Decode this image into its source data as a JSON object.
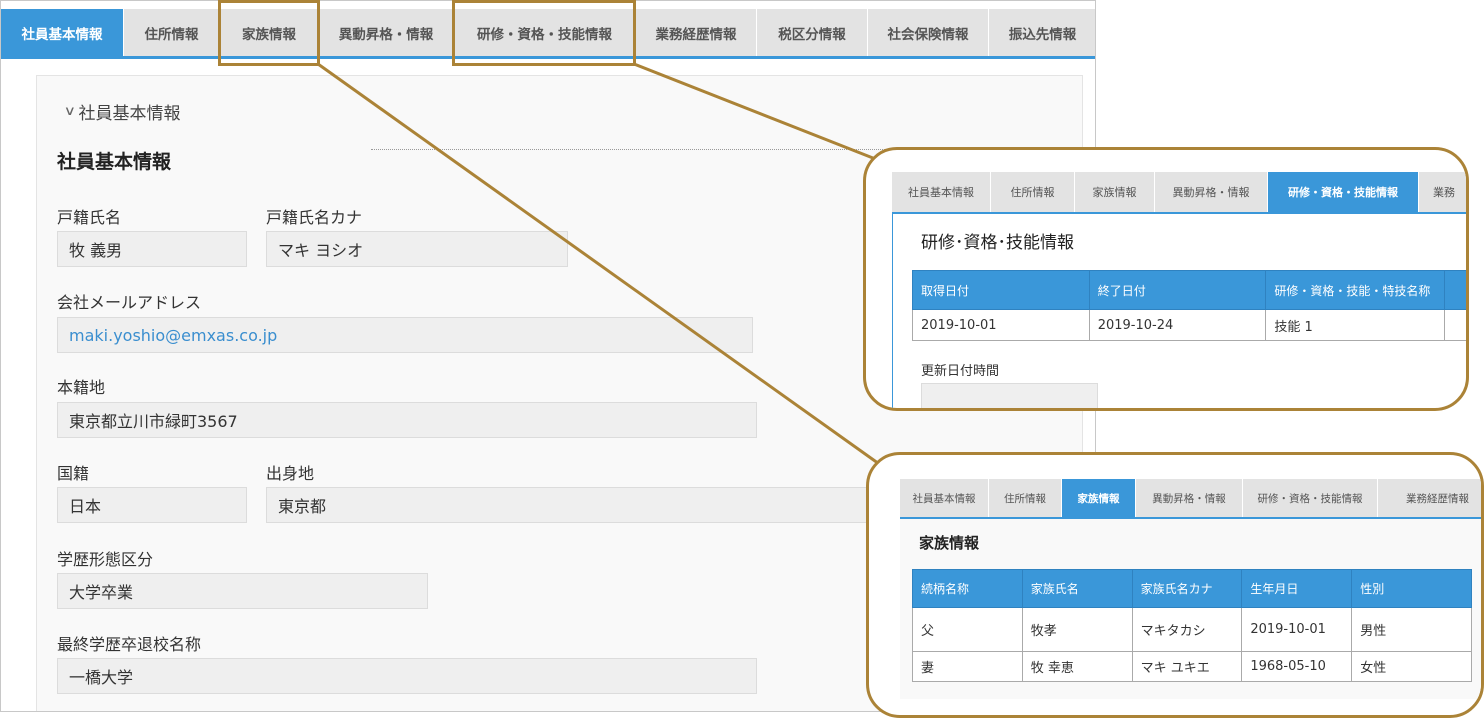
{
  "main": {
    "tabs": [
      "社員基本情報",
      "住所情報",
      "家族情報",
      "異動昇格・情報",
      "研修・資格・技能情報",
      "業務経歴情報",
      "税区分情報",
      "社会保険情報",
      "振込先情報"
    ],
    "section_toggle": "社員基本情報",
    "heading": "社員基本情報",
    "fields": {
      "legal_name_label": "戸籍氏名",
      "legal_name": "牧 義男",
      "legal_kana_label": "戸籍氏名カナ",
      "legal_kana": "マキ ヨシオ",
      "email_label": "会社メールアドレス",
      "email": "maki.yoshio@emxas.co.jp",
      "domicile_label": "本籍地",
      "domicile": "東京都立川市緑町3567",
      "nationality_label": "国籍",
      "nationality": "日本",
      "birthplace_label": "出身地",
      "birthplace": "東京都",
      "education_type_label": "学歴形態区分",
      "education_type": "大学卒業",
      "school_label": "最終学歴卒退校名称",
      "school": "一橋大学"
    }
  },
  "callout_training": {
    "tabs": [
      "社員基本情報",
      "住所情報",
      "家族情報",
      "異動昇格・情報",
      "研修・資格・技能情報",
      "業務"
    ],
    "title": "研修･資格･技能情報",
    "headers": [
      "取得日付",
      "終了日付",
      "研修・資格・技能・特技名称"
    ],
    "rows": [
      [
        "2019-10-01",
        "2019-10-24",
        "技能 1"
      ]
    ],
    "updated_label": "更新日付時間"
  },
  "callout_family": {
    "tabs": [
      "社員基本情報",
      "住所情報",
      "家族情報",
      "異動昇格・情報",
      "研修・資格・技能情報",
      "業務経歴情報"
    ],
    "title": "家族情報",
    "headers": [
      "続柄名称",
      "家族氏名",
      "家族氏名カナ",
      "生年月日",
      "性別"
    ],
    "rows": [
      [
        "父",
        "牧孝",
        "マキタカシ",
        "2019-10-01",
        "男性"
      ],
      [
        "妻",
        "牧 幸恵",
        "マキ ユキエ",
        "1968-05-10",
        "女性"
      ]
    ]
  },
  "colors": {
    "accent": "#3a97d9",
    "callout_border": "#ab8337",
    "link": "#3a8ecf"
  }
}
